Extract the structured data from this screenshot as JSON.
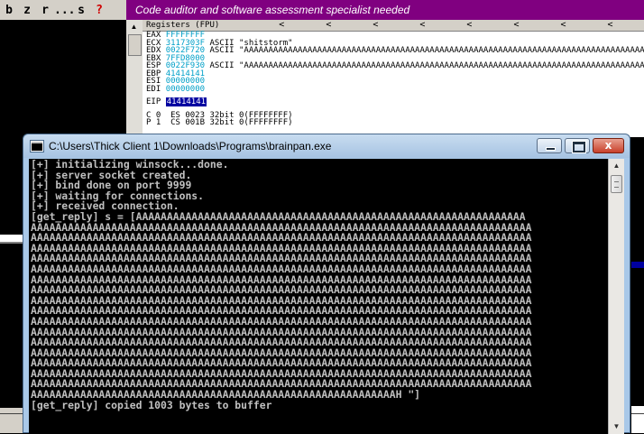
{
  "debugger": {
    "toolbar": {
      "b": "b",
      "z": "z",
      "r": "r",
      "more": "...",
      "s": "s",
      "help": "?"
    },
    "banner": "Code auditor and software assessment specialist needed",
    "registers": {
      "header": "Registers (FPU)",
      "nav": [
        "<",
        "<",
        "<",
        "<",
        "<",
        "<",
        "<",
        "<"
      ],
      "lines": [
        {
          "name": "EAX",
          "value": "FFFFFFFF",
          "extra": ""
        },
        {
          "name": "ECX",
          "value": "3117303F",
          "extra": "ASCII \"shitstorm\""
        },
        {
          "name": "EDX",
          "value": "0022F720",
          "extra": "ASCII \"AAAAAAAAAAAAAAAAAAAAAAAAAAAAAAAAAAAAAAAAAAAAAAAAAAAAAAAAAAAAAAAAAAAAAAAAAAAAAAAAAAAAA\""
        },
        {
          "name": "EBX",
          "value": "7FFD8000",
          "extra": ""
        },
        {
          "name": "ESP",
          "value": "0022F930",
          "extra": "ASCII \"AAAAAAAAAAAAAAAAAAAAAAAAAAAAAAAAAAAAAAAAAAAAAAAAAAAAAAAAAAAAAAAAAAAAAAAAAAAAAAAAAAAAA\""
        },
        {
          "name": "EBP",
          "value": "41414141",
          "extra": ""
        },
        {
          "name": "ESI",
          "value": "00000000",
          "extra": ""
        },
        {
          "name": "EDI",
          "value": "00000000",
          "extra": ""
        }
      ],
      "eip": {
        "name": "EIP",
        "value": "41414141"
      },
      "flags": [
        "C 0  ES 0023 32bit 0(FFFFFFFF)",
        "P 1  CS 001B 32bit 0(FFFFFFFF)"
      ]
    }
  },
  "console_window": {
    "title": "C:\\Users\\Thick Client 1\\Downloads\\Programs\\brainpan.exe",
    "close_glyph": "x",
    "lines": [
      "[+] initializing winsock...done.",
      "[+] server socket created.",
      "[+] bind done on port 9999",
      "[+] waiting for connections.",
      "[+] received connection.",
      "[get_reply] s = [AAAAAAAAAAAAAAAAAAAAAAAAAAAAAAAAAAAAAAAAAAAAAAAAAAAAAAAAAAAAAAA",
      "AAAAAAAAAAAAAAAAAAAAAAAAAAAAAAAAAAAAAAAAAAAAAAAAAAAAAAAAAAAAAAAAAAAAAAAAAAAAAAAAA",
      "AAAAAAAAAAAAAAAAAAAAAAAAAAAAAAAAAAAAAAAAAAAAAAAAAAAAAAAAAAAAAAAAAAAAAAAAAAAAAAAAA",
      "AAAAAAAAAAAAAAAAAAAAAAAAAAAAAAAAAAAAAAAAAAAAAAAAAAAAAAAAAAAAAAAAAAAAAAAAAAAAAAAAA",
      "AAAAAAAAAAAAAAAAAAAAAAAAAAAAAAAAAAAAAAAAAAAAAAAAAAAAAAAAAAAAAAAAAAAAAAAAAAAAAAAAA",
      "AAAAAAAAAAAAAAAAAAAAAAAAAAAAAAAAAAAAAAAAAAAAAAAAAAAAAAAAAAAAAAAAAAAAAAAAAAAAAAAAA",
      "AAAAAAAAAAAAAAAAAAAAAAAAAAAAAAAAAAAAAAAAAAAAAAAAAAAAAAAAAAAAAAAAAAAAAAAAAAAAAAAAA",
      "AAAAAAAAAAAAAAAAAAAAAAAAAAAAAAAAAAAAAAAAAAAAAAAAAAAAAAAAAAAAAAAAAAAAAAAAAAAAAAAAA",
      "AAAAAAAAAAAAAAAAAAAAAAAAAAAAAAAAAAAAAAAAAAAAAAAAAAAAAAAAAAAAAAAAAAAAAAAAAAAAAAAAA",
      "AAAAAAAAAAAAAAAAAAAAAAAAAAAAAAAAAAAAAAAAAAAAAAAAAAAAAAAAAAAAAAAAAAAAAAAAAAAAAAAAA",
      "AAAAAAAAAAAAAAAAAAAAAAAAAAAAAAAAAAAAAAAAAAAAAAAAAAAAAAAAAAAAAAAAAAAAAAAAAAAAAAAAA",
      "AAAAAAAAAAAAAAAAAAAAAAAAAAAAAAAAAAAAAAAAAAAAAAAAAAAAAAAAAAAAAAAAAAAAAAAAAAAAAAAAA",
      "AAAAAAAAAAAAAAAAAAAAAAAAAAAAAAAAAAAAAAAAAAAAAAAAAAAAAAAAAAAAAAAAAAAAAAAAAAAAAAAAA",
      "AAAAAAAAAAAAAAAAAAAAAAAAAAAAAAAAAAAAAAAAAAAAAAAAAAAAAAAAAAAAAAAAAAAAAAAAAAAAAAAAA",
      "AAAAAAAAAAAAAAAAAAAAAAAAAAAAAAAAAAAAAAAAAAAAAAAAAAAAAAAAAAAAAAAAAAAAAAAAAAAAAAAAA",
      "AAAAAAAAAAAAAAAAAAAAAAAAAAAAAAAAAAAAAAAAAAAAAAAAAAAAAAAAAAAAAAAAAAAAAAAAAAAAAAAAA",
      "AAAAAAAAAAAAAAAAAAAAAAAAAAAAAAAAAAAAAAAAAAAAAAAAAAAAAAAAAAAAAAAAAAAAAAAAAAAAAAAAA",
      "AAAAAAAAAAAAAAAAAAAAAAAAAAAAAAAAAAAAAAAAAAAAAAAAAAAAAAAAAAAH \"]",
      "[get_reply] copied 1003 bytes to buffer"
    ]
  }
}
